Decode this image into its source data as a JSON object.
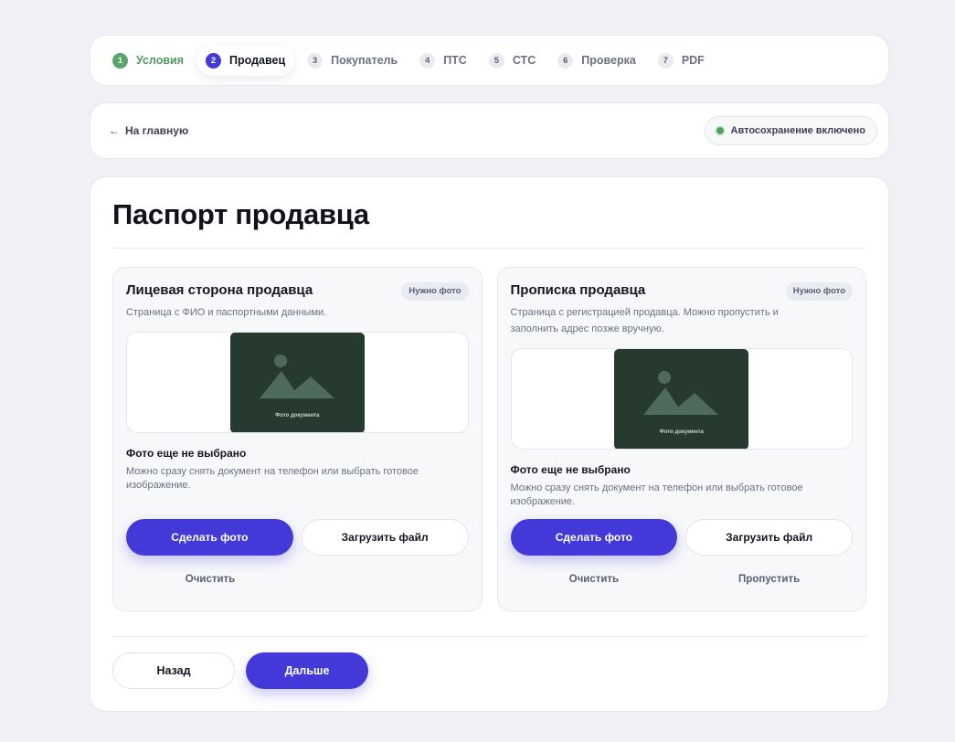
{
  "steps": [
    {
      "num": "1",
      "label": "Условия",
      "state": "done"
    },
    {
      "num": "2",
      "label": "Продавец",
      "state": "active"
    },
    {
      "num": "3",
      "label": "Покупатель",
      "state": "pending"
    },
    {
      "num": "4",
      "label": "ПТС",
      "state": "pending"
    },
    {
      "num": "5",
      "label": "СТС",
      "state": "pending"
    },
    {
      "num": "6",
      "label": "Проверка",
      "state": "pending"
    },
    {
      "num": "7",
      "label": "PDF",
      "state": "pending"
    }
  ],
  "nav": {
    "back_arrow": "←",
    "back_label": "На главную",
    "autosave_label": "Автосохранение включено"
  },
  "page": {
    "title": "Паспорт продавца"
  },
  "cards": [
    {
      "title": "Лицевая сторона продавца",
      "badge": "Нужно фото",
      "description": "Страница с ФИО и паспортными данными.",
      "photo_label": "Фото документа",
      "status_title": "Фото еще не выбрано",
      "status_desc": "Можно сразу снять документ на телефон или выбрать готовое изображение.",
      "take_photo": "Сделать фото",
      "upload": "Загрузить файл",
      "clear": "Очистить"
    },
    {
      "title": "Прописка продавца",
      "badge": "Нужно фото",
      "description": "Страница с регистрацией продавца. Можно пропустить и заполнить адрес позже вручную.",
      "photo_label": "Фото документа",
      "status_title": "Фото еще не выбрано",
      "status_desc": "Можно сразу снять документ на телефон или выбрать готовое изображение.",
      "take_photo": "Сделать фото",
      "upload": "Загрузить файл",
      "clear": "Очистить",
      "skip": "Пропустить"
    }
  ],
  "footer": {
    "back": "Назад",
    "next": "Дальше"
  },
  "colors": {
    "accent": "#4338d8",
    "success": "#5aa56a",
    "photo_bg": "#263a30"
  }
}
